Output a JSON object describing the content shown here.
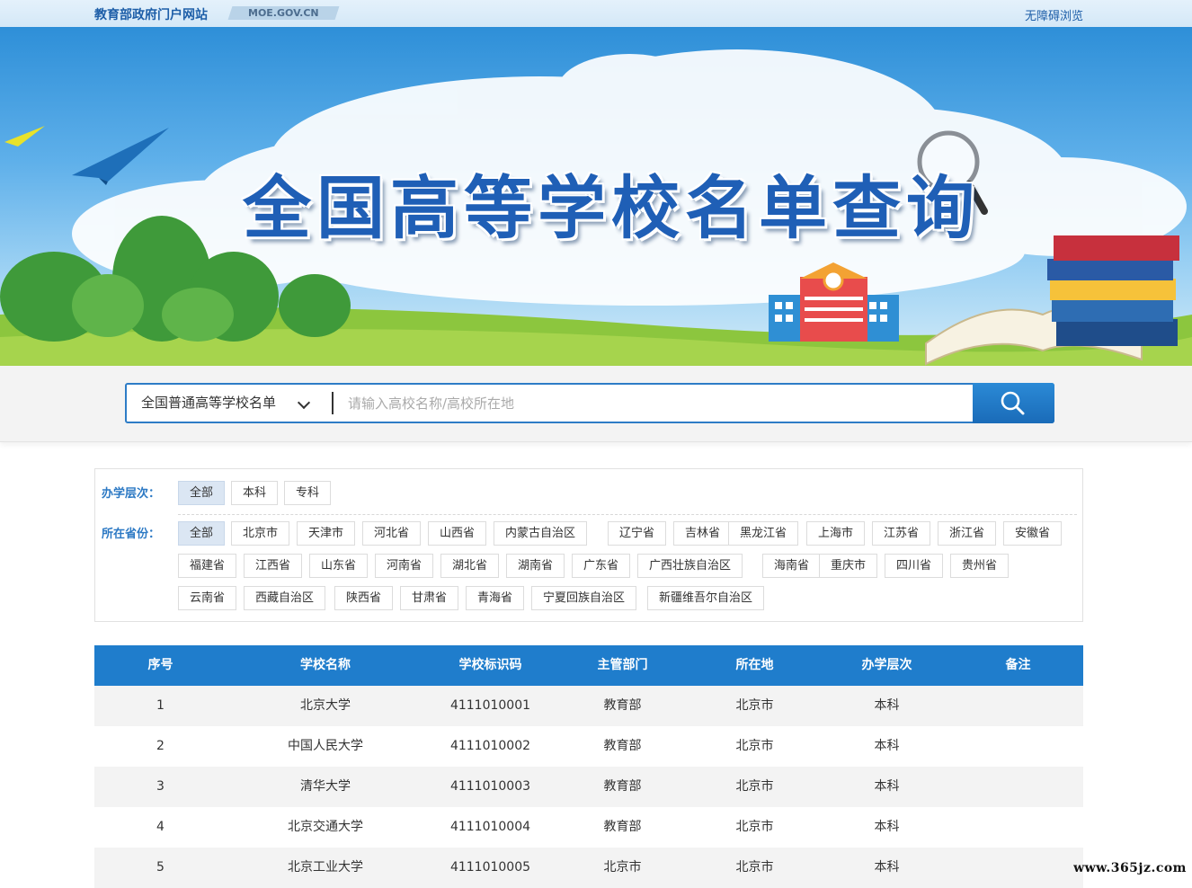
{
  "topbar": {
    "site_name": "教育部政府门户网站",
    "domain": "MOE.GOV.CN",
    "accessibility": "无障碍浏览"
  },
  "banner": {
    "title": "全国高等学校名单查询"
  },
  "search": {
    "category": "全国普通高等学校名单",
    "placeholder": "请输入高校名称/高校所在地",
    "button_icon": "search-icon"
  },
  "filters": {
    "level_label": "办学层次：",
    "levels": [
      "全部",
      "本科",
      "专科"
    ],
    "levels_selected": "全部",
    "province_label": "所在省份：",
    "provinces_row1": [
      "全部",
      "北京市",
      "天津市",
      "河北省",
      "山西省",
      "内蒙古自治区",
      "辽宁省",
      "吉林省",
      "黑龙江省",
      "上海市",
      "江苏省",
      "浙江省",
      "安徽省"
    ],
    "provinces_row2": [
      "福建省",
      "江西省",
      "山东省",
      "河南省",
      "湖北省",
      "湖南省",
      "广东省",
      "广西壮族自治区",
      "海南省",
      "重庆市",
      "四川省",
      "贵州省"
    ],
    "provinces_row3": [
      "云南省",
      "西藏自治区",
      "陕西省",
      "甘肃省",
      "青海省",
      "宁夏回族自治区",
      "新疆维吾尔自治区"
    ],
    "provinces_selected": "全部"
  },
  "table": {
    "headers": [
      "序号",
      "学校名称",
      "学校标识码",
      "主管部门",
      "所在地",
      "办学层次",
      "备注"
    ],
    "rows": [
      [
        "1",
        "北京大学",
        "4111010001",
        "教育部",
        "北京市",
        "本科",
        ""
      ],
      [
        "2",
        "中国人民大学",
        "4111010002",
        "教育部",
        "北京市",
        "本科",
        ""
      ],
      [
        "3",
        "清华大学",
        "4111010003",
        "教育部",
        "北京市",
        "本科",
        ""
      ],
      [
        "4",
        "北京交通大学",
        "4111010004",
        "教育部",
        "北京市",
        "本科",
        ""
      ],
      [
        "5",
        "北京工业大学",
        "4111010005",
        "北京市",
        "北京市",
        "本科",
        ""
      ]
    ]
  },
  "watermark": "www.365jz.com",
  "colors": {
    "brand_blue": "#1f7dcc",
    "label_blue": "#2c79c4",
    "chip_active": "#dbe6f3"
  }
}
